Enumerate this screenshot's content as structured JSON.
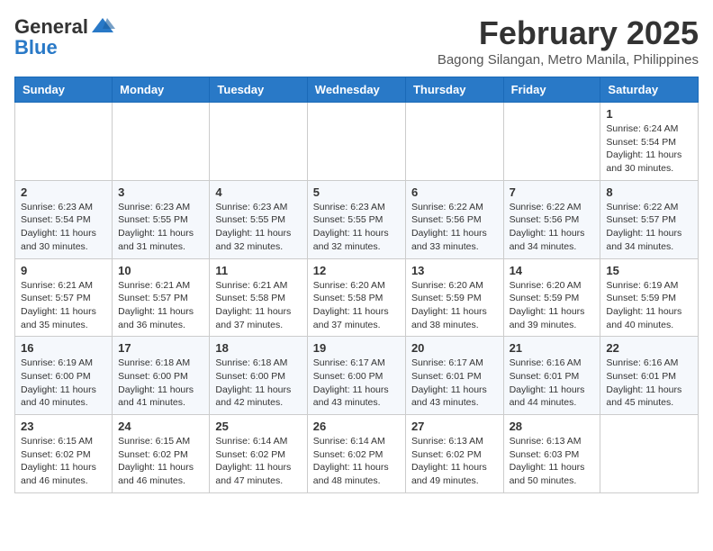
{
  "header": {
    "logo_general": "General",
    "logo_blue": "Blue",
    "month_year": "February 2025",
    "location": "Bagong Silangan, Metro Manila, Philippines"
  },
  "days_of_week": [
    "Sunday",
    "Monday",
    "Tuesday",
    "Wednesday",
    "Thursday",
    "Friday",
    "Saturday"
  ],
  "weeks": [
    [
      {
        "day": "",
        "detail": ""
      },
      {
        "day": "",
        "detail": ""
      },
      {
        "day": "",
        "detail": ""
      },
      {
        "day": "",
        "detail": ""
      },
      {
        "day": "",
        "detail": ""
      },
      {
        "day": "",
        "detail": ""
      },
      {
        "day": "1",
        "detail": "Sunrise: 6:24 AM\nSunset: 5:54 PM\nDaylight: 11 hours and 30 minutes."
      }
    ],
    [
      {
        "day": "2",
        "detail": "Sunrise: 6:23 AM\nSunset: 5:54 PM\nDaylight: 11 hours and 30 minutes."
      },
      {
        "day": "3",
        "detail": "Sunrise: 6:23 AM\nSunset: 5:55 PM\nDaylight: 11 hours and 31 minutes."
      },
      {
        "day": "4",
        "detail": "Sunrise: 6:23 AM\nSunset: 5:55 PM\nDaylight: 11 hours and 32 minutes."
      },
      {
        "day": "5",
        "detail": "Sunrise: 6:23 AM\nSunset: 5:55 PM\nDaylight: 11 hours and 32 minutes."
      },
      {
        "day": "6",
        "detail": "Sunrise: 6:22 AM\nSunset: 5:56 PM\nDaylight: 11 hours and 33 minutes."
      },
      {
        "day": "7",
        "detail": "Sunrise: 6:22 AM\nSunset: 5:56 PM\nDaylight: 11 hours and 34 minutes."
      },
      {
        "day": "8",
        "detail": "Sunrise: 6:22 AM\nSunset: 5:57 PM\nDaylight: 11 hours and 34 minutes."
      }
    ],
    [
      {
        "day": "9",
        "detail": "Sunrise: 6:21 AM\nSunset: 5:57 PM\nDaylight: 11 hours and 35 minutes."
      },
      {
        "day": "10",
        "detail": "Sunrise: 6:21 AM\nSunset: 5:57 PM\nDaylight: 11 hours and 36 minutes."
      },
      {
        "day": "11",
        "detail": "Sunrise: 6:21 AM\nSunset: 5:58 PM\nDaylight: 11 hours and 37 minutes."
      },
      {
        "day": "12",
        "detail": "Sunrise: 6:20 AM\nSunset: 5:58 PM\nDaylight: 11 hours and 37 minutes."
      },
      {
        "day": "13",
        "detail": "Sunrise: 6:20 AM\nSunset: 5:59 PM\nDaylight: 11 hours and 38 minutes."
      },
      {
        "day": "14",
        "detail": "Sunrise: 6:20 AM\nSunset: 5:59 PM\nDaylight: 11 hours and 39 minutes."
      },
      {
        "day": "15",
        "detail": "Sunrise: 6:19 AM\nSunset: 5:59 PM\nDaylight: 11 hours and 40 minutes."
      }
    ],
    [
      {
        "day": "16",
        "detail": "Sunrise: 6:19 AM\nSunset: 6:00 PM\nDaylight: 11 hours and 40 minutes."
      },
      {
        "day": "17",
        "detail": "Sunrise: 6:18 AM\nSunset: 6:00 PM\nDaylight: 11 hours and 41 minutes."
      },
      {
        "day": "18",
        "detail": "Sunrise: 6:18 AM\nSunset: 6:00 PM\nDaylight: 11 hours and 42 minutes."
      },
      {
        "day": "19",
        "detail": "Sunrise: 6:17 AM\nSunset: 6:00 PM\nDaylight: 11 hours and 43 minutes."
      },
      {
        "day": "20",
        "detail": "Sunrise: 6:17 AM\nSunset: 6:01 PM\nDaylight: 11 hours and 43 minutes."
      },
      {
        "day": "21",
        "detail": "Sunrise: 6:16 AM\nSunset: 6:01 PM\nDaylight: 11 hours and 44 minutes."
      },
      {
        "day": "22",
        "detail": "Sunrise: 6:16 AM\nSunset: 6:01 PM\nDaylight: 11 hours and 45 minutes."
      }
    ],
    [
      {
        "day": "23",
        "detail": "Sunrise: 6:15 AM\nSunset: 6:02 PM\nDaylight: 11 hours and 46 minutes."
      },
      {
        "day": "24",
        "detail": "Sunrise: 6:15 AM\nSunset: 6:02 PM\nDaylight: 11 hours and 46 minutes."
      },
      {
        "day": "25",
        "detail": "Sunrise: 6:14 AM\nSunset: 6:02 PM\nDaylight: 11 hours and 47 minutes."
      },
      {
        "day": "26",
        "detail": "Sunrise: 6:14 AM\nSunset: 6:02 PM\nDaylight: 11 hours and 48 minutes."
      },
      {
        "day": "27",
        "detail": "Sunrise: 6:13 AM\nSunset: 6:02 PM\nDaylight: 11 hours and 49 minutes."
      },
      {
        "day": "28",
        "detail": "Sunrise: 6:13 AM\nSunset: 6:03 PM\nDaylight: 11 hours and 50 minutes."
      },
      {
        "day": "",
        "detail": ""
      }
    ]
  ]
}
